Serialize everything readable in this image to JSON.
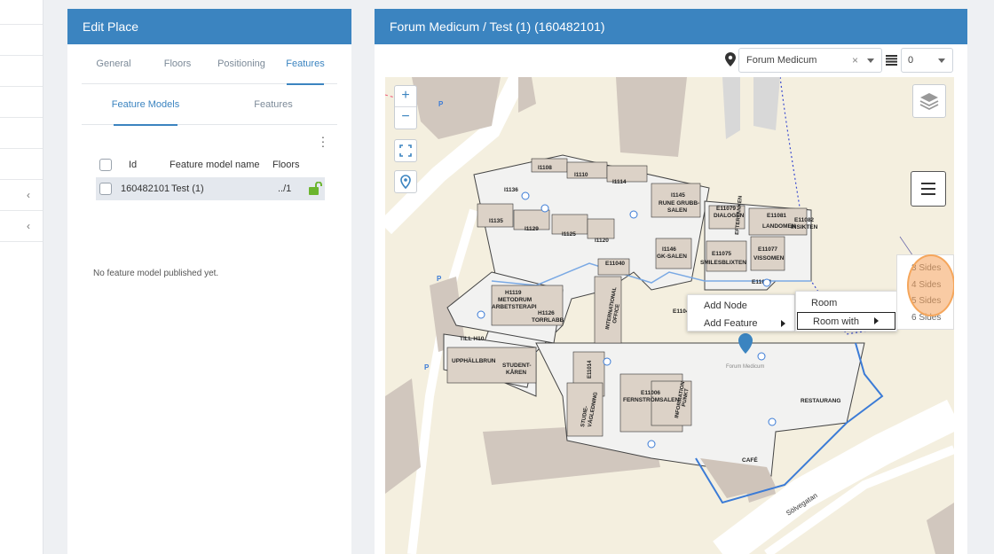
{
  "edit_panel": {
    "title": "Edit Place",
    "tabs": [
      "General",
      "Floors",
      "Positioning",
      "Features"
    ],
    "active_tab": "Features",
    "subtabs": [
      "Feature Models",
      "Features"
    ],
    "active_subtab": "Feature Models",
    "table": {
      "headers": {
        "id": "Id",
        "name": "Feature model name",
        "floors": "Floors"
      },
      "rows": [
        {
          "id": "160482101",
          "name": "Test (1)",
          "floors": "../1"
        }
      ]
    },
    "empty_message": "No feature model published yet."
  },
  "map_panel": {
    "title": "Forum Medicum / Test (1) (160482101)",
    "place_select": {
      "value": "Forum Medicum",
      "clear": "×"
    },
    "floor_select": {
      "value": "0"
    },
    "zoom": {
      "in": "+",
      "out": "−"
    },
    "context_menu": {
      "items": [
        "Add Node",
        "Add Feature"
      ]
    },
    "submenu": {
      "items": [
        "Room",
        "Room with"
      ]
    },
    "sides_menu": {
      "items": [
        "3 Sides",
        "4 Sides",
        "5 Sides",
        "6 Sides"
      ]
    },
    "room_labels": {
      "i1108": "I1108",
      "i1110": "I1110",
      "i1114": "I1114",
      "i1136": "I1136",
      "i1145": "I1145",
      "rune1": "RUNE GRUBB-",
      "rune2": "SALEN",
      "i1135": "I1135",
      "i1129": "I1129",
      "i1125": "I1125",
      "i1120": "I1120",
      "e11079": "E11079",
      "dialogen": "DIALOGEN",
      "e11081": "E11081",
      "e11082": "E11082",
      "landomen": "LANDOMEN",
      "insikten": "INSIKTEN",
      "eftertanken": "EFTERTANKEN",
      "i1146": "I1146",
      "gksalen": "GK-SALEN",
      "e11075": "E11075",
      "smilesblixten": "SMILESBLIXTEN",
      "e11077": "E11077",
      "vissomen": "VISSOMEN",
      "e11040": "E11040",
      "e11074": "E11074",
      "h1119": "H1119",
      "metodrum": "METODRUM",
      "arbetsterapi": "ARBETSTERAPI",
      "h1126": "H1126",
      "torrlabb": "TORRLABB",
      "international": "INTERNATIONAL",
      "office": "OFFICE",
      "e1104": "E1104",
      "till_h10": "TILL H10",
      "upphallbrun": "UPPHÄLLBRUN",
      "student": "STUDENT-",
      "karen": "KÅREN",
      "e11014": "E11014",
      "studie": "STUDIE-",
      "vagledning": "VÄGLEDNING",
      "e11006": "E11006",
      "fernstromsalen": "FERNSTRÖMSALEN",
      "information": "INFORMATION",
      "punkt": "PUNKT",
      "forum_medicum": "Forum Medicum",
      "restaurang": "RESTAURANG",
      "cafe": "CAFÉ",
      "solvegatan": "Sölvegatan"
    }
  },
  "colors": {
    "header_blue": "#3b84c0",
    "map_background": "#f4efdf",
    "building_fill": "#f2f2f1",
    "building_dark": "#d8d0c9",
    "room_brown": "#dcd2c7",
    "highlight_orange": "#f5a65b"
  }
}
